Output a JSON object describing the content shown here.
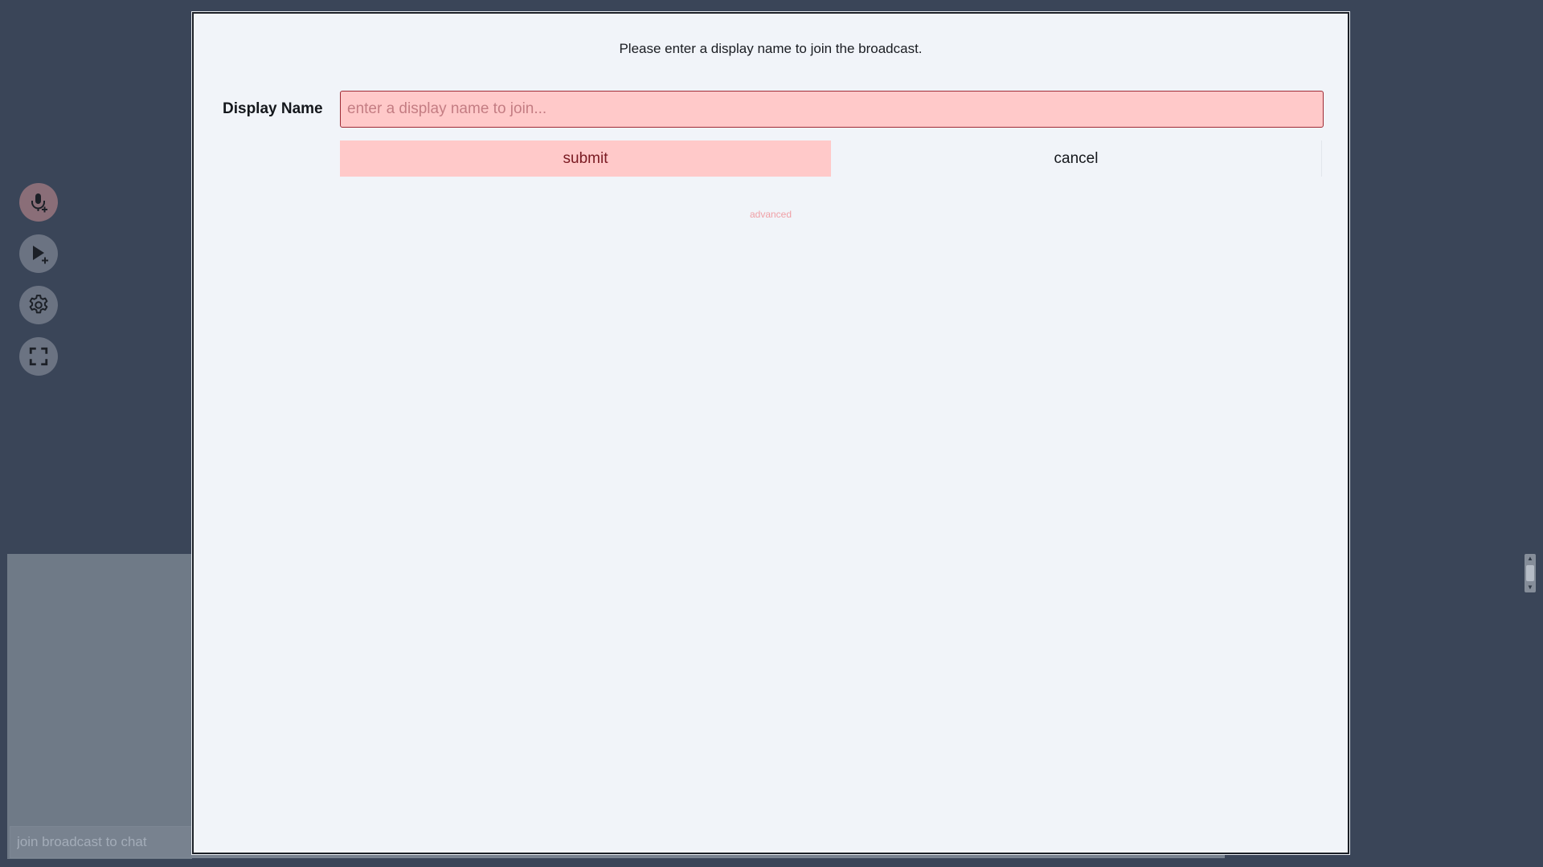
{
  "sidebar": {
    "buttons": [
      {
        "icon": "microphone-plus-icon",
        "label": "add microphone"
      },
      {
        "icon": "play-plus-icon",
        "label": "add media"
      },
      {
        "icon": "gear-icon",
        "label": "settings"
      },
      {
        "icon": "fullscreen-icon",
        "label": "fullscreen"
      }
    ]
  },
  "chat": {
    "placeholder": "join broadcast to chat"
  },
  "modal": {
    "message": "Please enter a display name to join the broadcast.",
    "field_label": "Display Name",
    "input_placeholder": "enter a display name to join...",
    "input_value": "",
    "submit_label": "submit",
    "cancel_label": "cancel",
    "advanced_label": "advanced"
  },
  "colors": {
    "background": "#3a4558",
    "modal_background": "#f1f4f9",
    "accent_pink": "#ffc9c9",
    "accent_dark_red": "#9e2a35"
  }
}
